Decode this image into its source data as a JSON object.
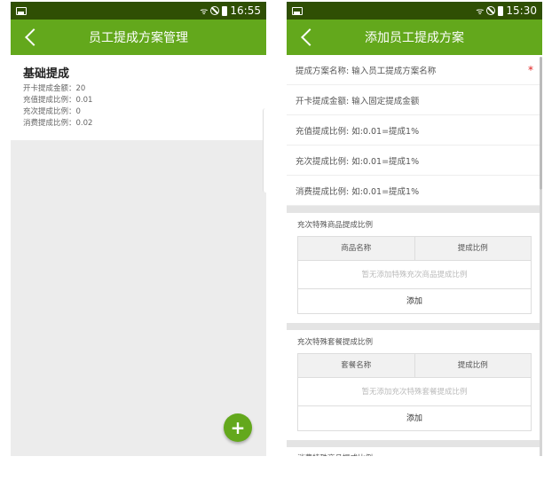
{
  "left": {
    "status": {
      "time": "16:55"
    },
    "title": "员工提成方案管理",
    "schemes": [
      {
        "name": "基础提成",
        "lines": [
          "开卡提成金额：20",
          "充值提成比例：0.01",
          "充次提成比例：0",
          "消费提成比例：0.02"
        ]
      }
    ],
    "fab_label": "+"
  },
  "right": {
    "status": {
      "time": "15:30"
    },
    "title": "添加员工提成方案",
    "fields": [
      {
        "text": "提成方案名称: 输入员工提成方案名称",
        "required_mark": "*"
      },
      {
        "text": "开卡提成金额: 输入固定提成金额"
      },
      {
        "text": "充值提成比例: 如:0.01=提成1%"
      },
      {
        "text": "充次提成比例: 如:0.01=提成1%"
      },
      {
        "text": "消费提成比例: 如:0.01=提成1%"
      }
    ],
    "sections": [
      {
        "title": "充次特殊商品提成比例",
        "columns": [
          "商品名称",
          "提成比例"
        ],
        "empty_text": "暂无添加特殊充次商品提成比例",
        "add_label": "添加"
      },
      {
        "title": "充次特殊套餐提成比例",
        "columns": [
          "套餐名称",
          "提成比例"
        ],
        "empty_text": "暂无添加充次特殊套餐提成比例",
        "add_label": "添加"
      }
    ],
    "last_section_title": "消费特殊商品提成比例"
  },
  "colors": {
    "appbar": "#63a81c",
    "statusbar": "#2f4f04",
    "required": "#e02020"
  }
}
